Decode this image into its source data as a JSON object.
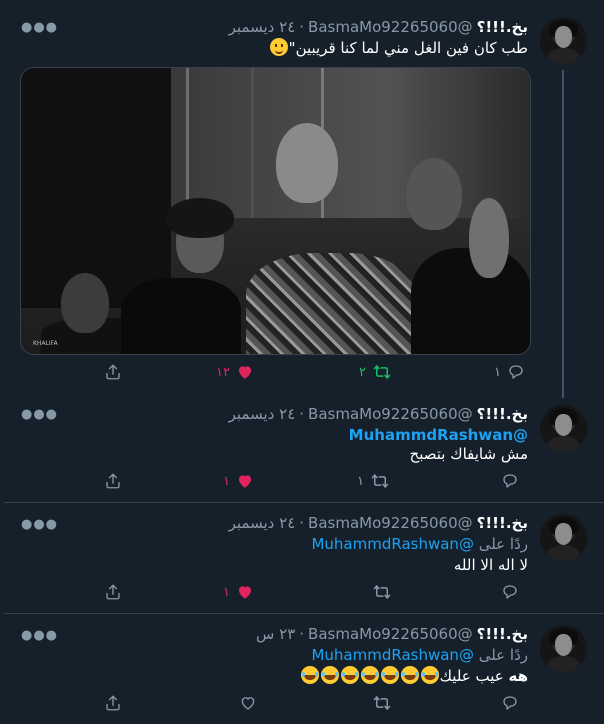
{
  "tweets": [
    {
      "name": "بخ.!!!؟",
      "handle": "@BasmaMo92265060",
      "dot": "·",
      "time": "٢٤ ديسمبر",
      "text": "طب كان فين الغل مني لما كنا قريبين\"",
      "emoji": "slightly-smiling-face",
      "media_watermark": "KHALIFA",
      "replies": "١",
      "retweets": "٢",
      "likes": "١٢",
      "liked": true,
      "retweeted": true
    },
    {
      "name": "بخ.!!!؟",
      "handle": "@BasmaMo92265060",
      "dot": "·",
      "time": "٢٤ ديسمبر",
      "mention": "@MuhammdRashwan",
      "text": "مش شايفاك بتصبح",
      "replies": "",
      "retweets": "١",
      "likes": "١",
      "liked": true
    },
    {
      "name": "بخ.!!!؟",
      "handle": "@BasmaMo92265060",
      "dot": "·",
      "time": "٢٤ ديسمبر",
      "reply_prefix": "ردًا على",
      "mention": "@MuhammdRashwan",
      "text": "لا اله الا الله",
      "replies": "",
      "retweets": "",
      "likes": "١",
      "liked": true
    },
    {
      "name": "بخ.!!!؟",
      "handle": "@BasmaMo92265060",
      "dot": "·",
      "time": "٢٣ س",
      "reply_prefix": "ردًا على",
      "mention": "@MuhammdRashwan",
      "text_bold": "هه",
      "text": "عيب عليك",
      "emoji": "face-with-tears-of-joy",
      "emoji_count": 7,
      "replies": "",
      "retweets": "",
      "likes": "",
      "liked": false
    }
  ],
  "icons": {
    "more": "more-icon",
    "reply": "reply-icon",
    "retweet": "retweet-icon",
    "like": "heart-icon",
    "share": "share-icon"
  },
  "colors": {
    "background": "#15202b",
    "secondary_text": "#8899a6",
    "link": "#1da1f2",
    "retweet_active": "#17bf63",
    "like_active": "#e0245e"
  }
}
